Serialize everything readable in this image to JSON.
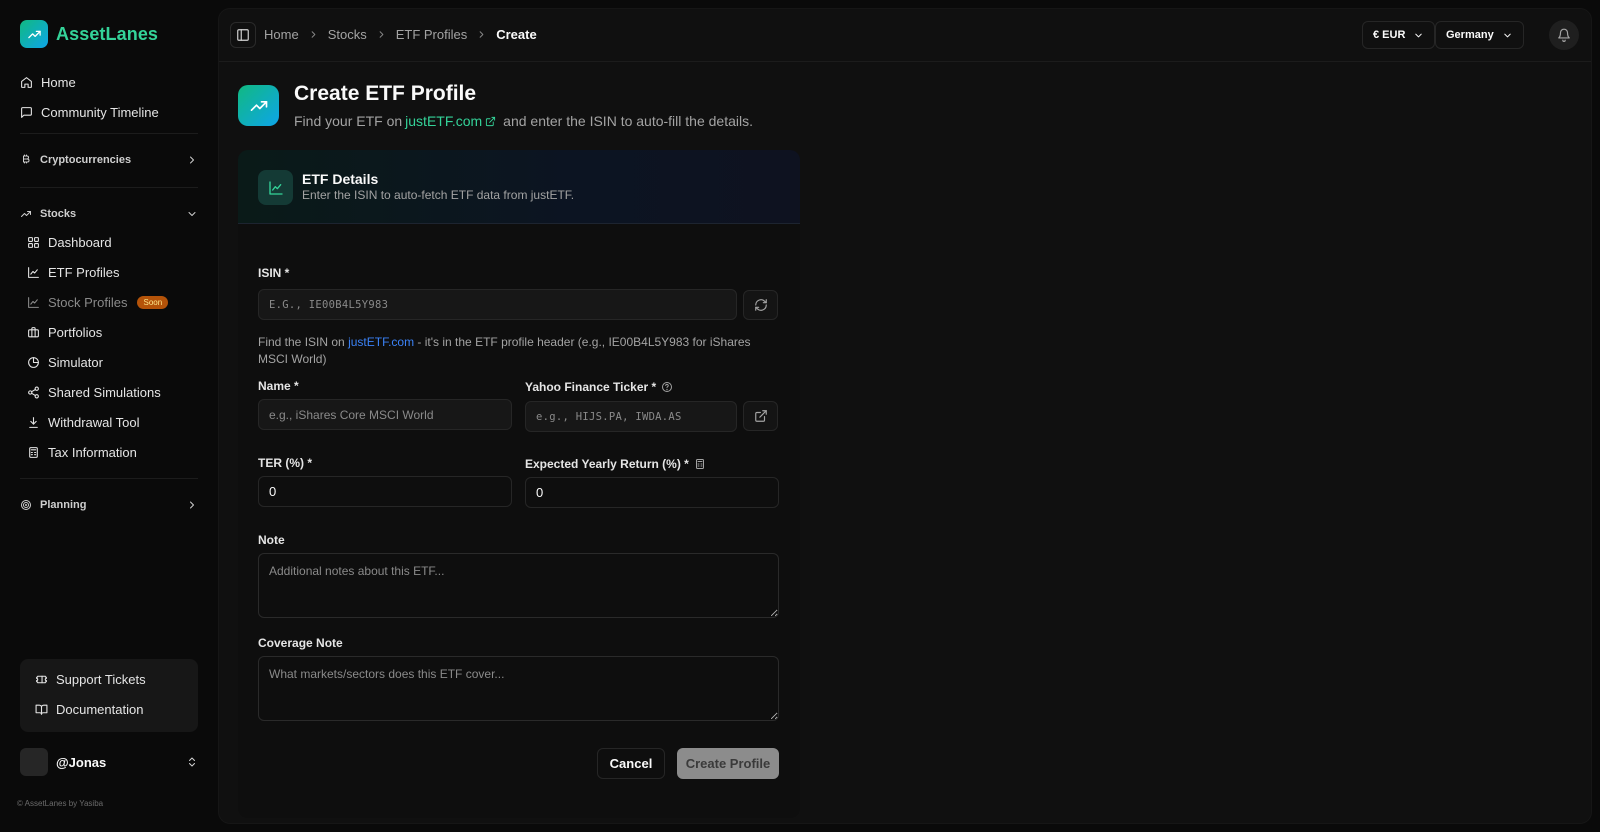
{
  "app": {
    "name": "AssetLanes"
  },
  "sidebar": {
    "home": "Home",
    "community": "Community Timeline",
    "crypto_group": "Cryptocurrencies",
    "stocks_group": "Stocks",
    "stocks_items": {
      "dashboard": "Dashboard",
      "etf_profiles": "ETF Profiles",
      "stock_profiles": "Stock Profiles",
      "stock_profiles_badge": "Soon",
      "portfolios": "Portfolios",
      "simulator": "Simulator",
      "shared_simulations": "Shared Simulations",
      "withdrawal_tool": "Withdrawal Tool",
      "tax_information": "Tax Information"
    },
    "planning_group": "Planning",
    "support_tickets": "Support Tickets",
    "documentation": "Documentation",
    "user": "@Jonas",
    "footer": "© AssetLanes by Yasiba"
  },
  "topbar": {
    "breadcrumb": [
      "Home",
      "Stocks",
      "ETF Profiles",
      "Create"
    ],
    "currency": "€ EUR",
    "country": "Germany"
  },
  "page": {
    "title": "Create ETF Profile",
    "subtitle_pre": "Find your ETF on",
    "subtitle_link": "justETF.com",
    "subtitle_post": "and enter the ISIN to auto-fill the details."
  },
  "card": {
    "title": "ETF Details",
    "description": "Enter the ISIN to auto-fetch ETF data from justETF."
  },
  "form": {
    "isin_label": "ISIN *",
    "isin_placeholder": "E.G., IE00B4L5Y983",
    "isin_hint_pre": "Find the ISIN on",
    "isin_hint_link": "justETF.com",
    "isin_hint_post": "- it's in the ETF profile header (e.g., IE00B4L5Y983 for iShares MSCI World)",
    "name_label": "Name *",
    "name_placeholder": "e.g., iShares Core MSCI World",
    "ticker_label": "Yahoo Finance Ticker *",
    "ticker_placeholder": "e.g., HIJS.PA, IWDA.AS",
    "ter_label": "TER (%) *",
    "ter_value": "0",
    "return_label": "Expected Yearly Return (%) *",
    "return_value": "0",
    "note_label": "Note",
    "note_placeholder": "Additional notes about this ETF...",
    "coverage_label": "Coverage Note",
    "coverage_placeholder": "What markets/sectors does this ETF cover...",
    "cancel": "Cancel",
    "create": "Create Profile"
  }
}
